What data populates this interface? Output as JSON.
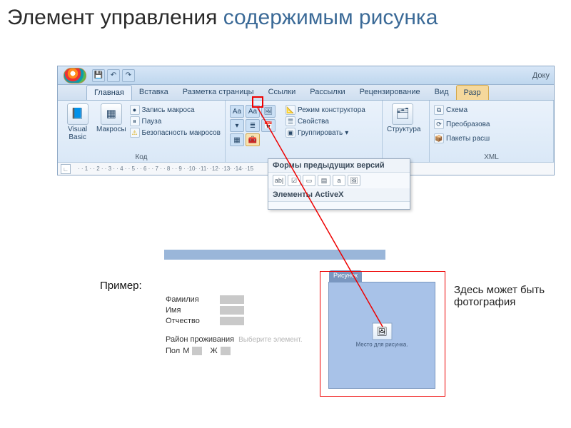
{
  "slide": {
    "title_plain": "Элемент управления",
    "title_accent": "содержимым рисунка"
  },
  "titlebar": {
    "doc_label": "Доку"
  },
  "qat": {
    "save": "💾",
    "undo": "↶",
    "redo": "↷"
  },
  "tabs": {
    "home": "Главная",
    "insert": "Вставка",
    "layout": "Разметка страницы",
    "refs": "Ссылки",
    "mail": "Рассылки",
    "review": "Рецензирование",
    "view": "Вид",
    "dev": "Разр"
  },
  "groups": {
    "code": {
      "label": "Код",
      "vb": "Visual\nBasic",
      "macros": "Макросы",
      "record": "Запись макроса",
      "pause": "Пауза",
      "security": "Безопасность макросов"
    },
    "controls": {
      "design": "Режим конструктора",
      "props": "Свойства",
      "group": "Группировать"
    },
    "structure": {
      "btn": "Структура"
    },
    "xml": {
      "label": "XML",
      "schema": "Схема",
      "transform": "Преобразова",
      "packs": "Пакеты расш"
    }
  },
  "dropdown": {
    "legacy_title": "Формы предыдущих версий",
    "activex_title": "Элементы ActiveX",
    "items": {
      "ab": "ab|",
      "chk": "☑",
      "cmb": "▭",
      "lst": "▤",
      "a": "a",
      "pic": "🖼"
    }
  },
  "example": {
    "label": "Пример:",
    "lastname": "Фамилия",
    "firstname": "Имя",
    "patronymic": "Отчество",
    "region": "Район проживания",
    "region_hint": "Выберите элемент.",
    "gender": "Пол",
    "m": "М",
    "f": "Ж"
  },
  "picture": {
    "tab": "Рисунок",
    "placeholder": "Место для рисунка."
  },
  "annotation": "Здесь может быть фотография"
}
